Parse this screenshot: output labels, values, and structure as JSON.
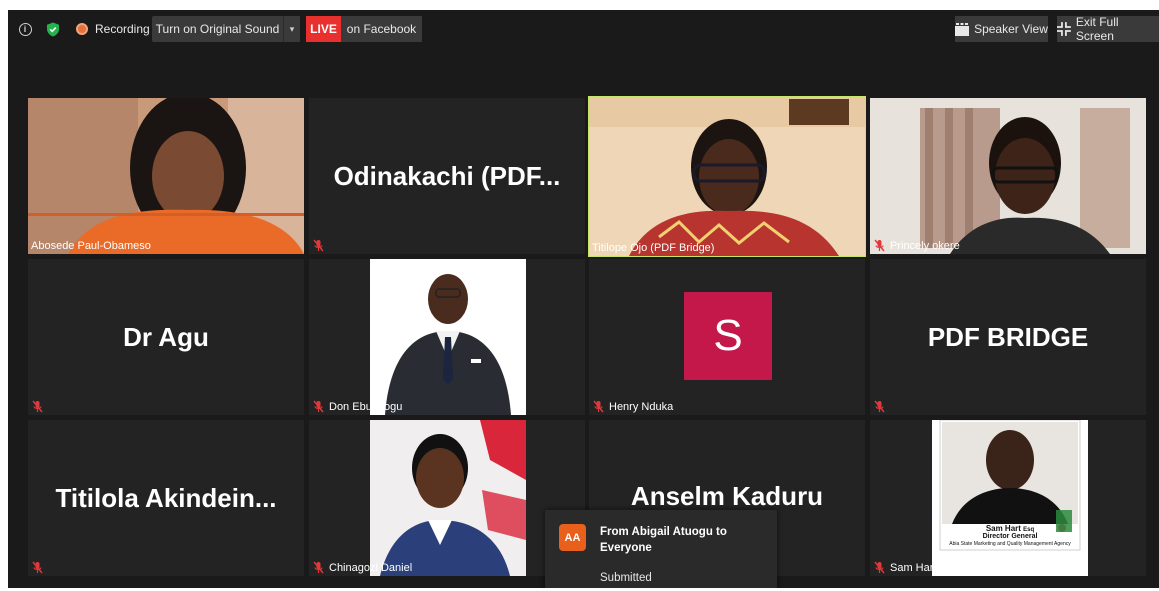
{
  "topbar": {
    "recording_label": "Recording",
    "sound_button_label": "Turn on Original Sound",
    "sound_caret": "▾",
    "live_badge": "LIVE",
    "live_platform": "on Facebook",
    "speaker_view_label": "Speaker View",
    "exit_full_screen_label": "Exit Full Screen"
  },
  "participants": [
    {
      "name": "Abosede Paul-Obameso",
      "display": "video",
      "muted": false
    },
    {
      "name": "Odinakachi  (PDF...",
      "display": "name",
      "muted": true
    },
    {
      "name": "Titilope Ojo (PDF Bridge)",
      "display": "video",
      "muted": false,
      "active_speaker": true
    },
    {
      "name": "Princely okere",
      "display": "video",
      "muted": true
    },
    {
      "name": "Dr Agu",
      "display": "name",
      "muted": true
    },
    {
      "name": "Don Ebubeogu",
      "display": "photo",
      "muted": true
    },
    {
      "name": "Henry Nduka",
      "display": "avatar",
      "avatar_letter": "S",
      "avatar_color": "#c4174a",
      "muted": true
    },
    {
      "name": "PDF BRIDGE",
      "display": "name",
      "muted": true
    },
    {
      "name": "Titilola  Akindein...",
      "display": "name",
      "muted": true
    },
    {
      "name": "Chinagozi Daniel",
      "display": "photo",
      "muted": true
    },
    {
      "name": "Anselm Kaduru",
      "display": "name",
      "muted": true
    },
    {
      "name": "Sam Hart",
      "display": "photo",
      "muted": true
    }
  ],
  "sam_hart_card": {
    "name_line": "Sam Hart",
    "name_suffix": "Esq",
    "title_line": "Director General",
    "org_line": "Abia State Marketing and Quality Management Agency"
  },
  "chat_notification": {
    "avatar_initials": "AA",
    "avatar_color": "#e8601c",
    "from_line": "From Abigail Atuogu to Everyone",
    "message": "Submitted"
  },
  "colors": {
    "background": "#1a1a1a",
    "tile": "#232323",
    "active_speaker_border": "#c6e36a",
    "live_red": "#e8302f",
    "muted_icon_red": "#e0383b"
  }
}
